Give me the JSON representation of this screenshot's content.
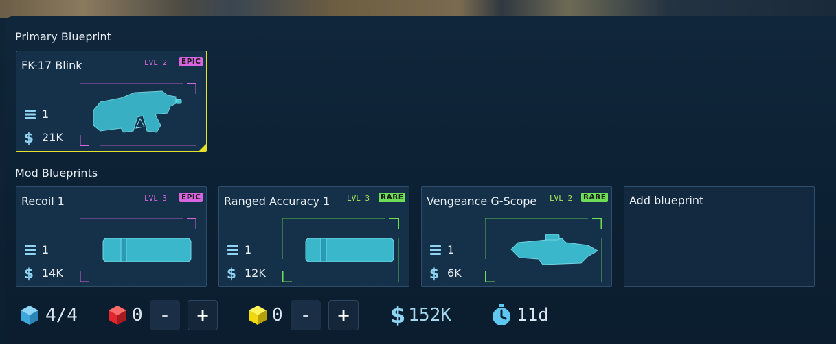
{
  "sections": {
    "primary_title": "Primary Blueprint",
    "mods_title": "Mod Blueprints"
  },
  "primary": {
    "name": "FK-17 Blink",
    "level": "LVL 2",
    "rarity": "EPIC",
    "count": "1",
    "cost": "21K",
    "icon": "smg-icon",
    "accent": "#d865e0"
  },
  "mods": [
    {
      "name": "Recoil 1",
      "level": "LVL 3",
      "rarity": "EPIC",
      "count": "1",
      "cost": "14K",
      "icon": "suppressor-icon",
      "accent": "#d865e0"
    },
    {
      "name": "Ranged Accuracy 1",
      "level": "LVL 3",
      "rarity": "RARE",
      "count": "1",
      "cost": "12K",
      "icon": "suppressor-icon",
      "accent": "#6ede56"
    },
    {
      "name": "Vengeance G-Scope",
      "level": "LVL 2",
      "rarity": "RARE",
      "count": "1",
      "cost": "6K",
      "icon": "scope-icon",
      "accent": "#6ede56"
    }
  ],
  "add_card": {
    "label": "Add blueprint"
  },
  "footer": {
    "slots": "4/4",
    "red_count": "0",
    "yellow_count": "0",
    "minus": "-",
    "plus": "+",
    "total_cost": "152K",
    "time": "11d"
  },
  "colors": {
    "epic": "#d865e0",
    "rare": "#6ede56",
    "primary_border": "#e6e22a",
    "icon_blue": "#5ec8f0"
  }
}
